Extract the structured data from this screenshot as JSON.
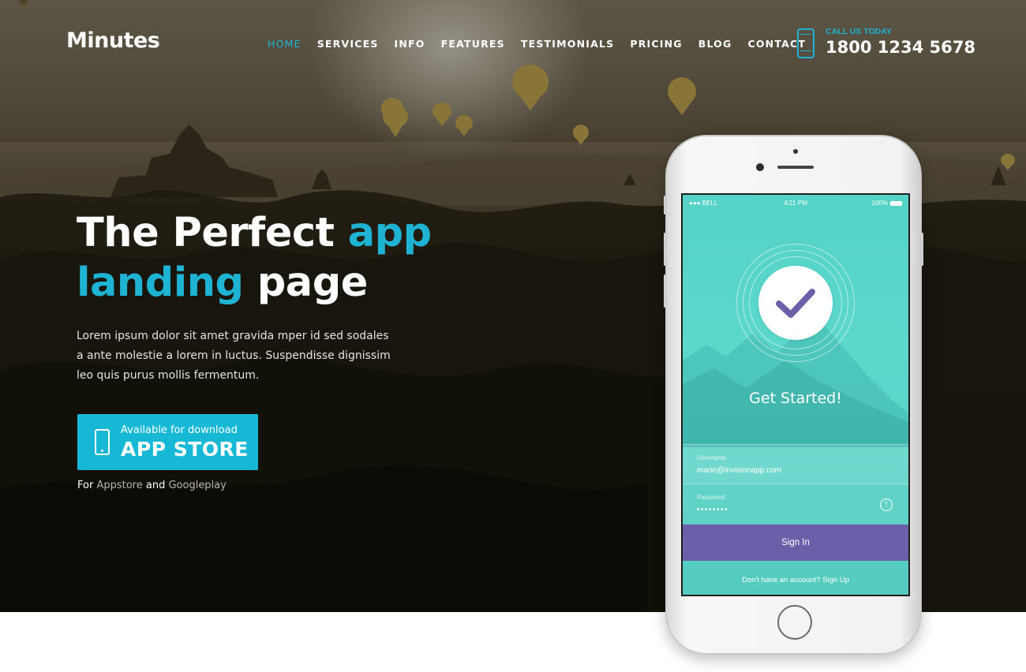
{
  "brand": {
    "logo": "Minutes"
  },
  "nav": {
    "items": [
      {
        "label": "HOME",
        "active": true
      },
      {
        "label": "SERVICES"
      },
      {
        "label": "INFO"
      },
      {
        "label": "FEATURES"
      },
      {
        "label": "TESTIMONIALS"
      },
      {
        "label": "PRICING"
      },
      {
        "label": "BLOG"
      },
      {
        "label": "CONTACT"
      }
    ]
  },
  "contact": {
    "label": "CALL US TODAY",
    "number": "1800 1234 5678",
    "icon": "mobile-phone-icon"
  },
  "hero": {
    "headline_part1": "The Perfect ",
    "headline_accent1": "app",
    "headline_accent2": "landing",
    "headline_part2": " page",
    "lead": "Lorem ipsum dolor sit amet gravida mper id sed sodales a ante molestie a lorem in luctus. Suspendisse dignissim leo quis purus mollis fermentum.",
    "download_small": "Available for download",
    "download_big": "APP STORE",
    "note_prefix": "For ",
    "note_link1": "Appstore",
    "note_and": " and ",
    "note_link2": "Googleplay"
  },
  "device": {
    "status_left": "●●● BELL",
    "status_time": "4:21 PM",
    "status_right": "100%",
    "title": "Get Started!",
    "username_label": "Username",
    "username_value": "marie@invisionapp.com",
    "password_label": "Password",
    "password_value": "••••••••",
    "signin_label": "Sign In",
    "signup_text": "Don't have an account? Sign Up"
  },
  "colors": {
    "accent": "#1fb3d3",
    "button": "#16b8d6",
    "signin": "#6a5fa8",
    "screen": "#5cd8cb"
  }
}
